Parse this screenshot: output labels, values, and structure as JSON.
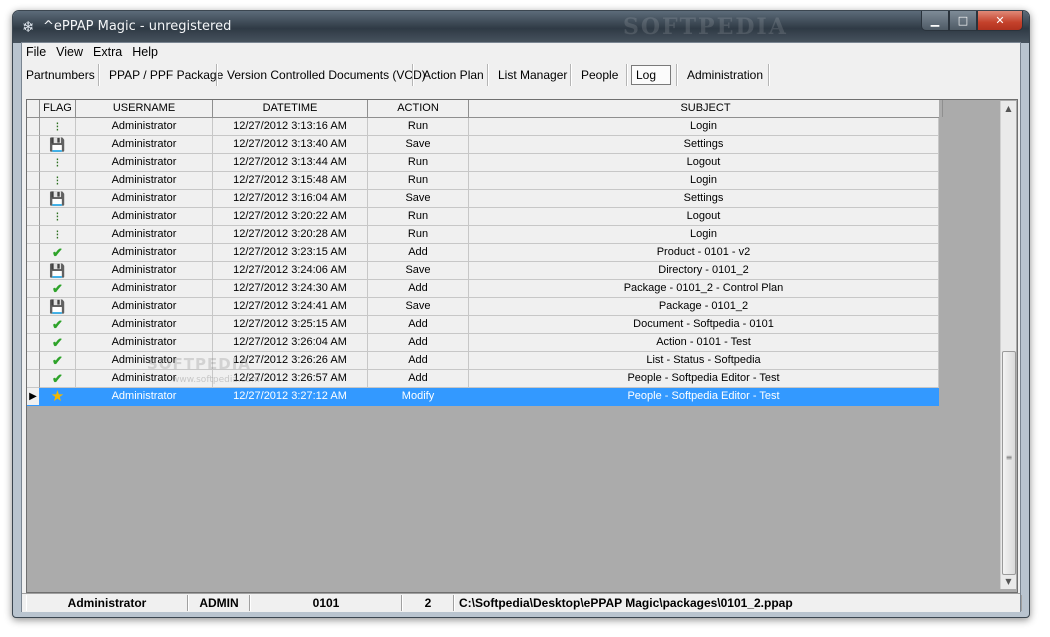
{
  "window": {
    "title": "^ePPAP Magic - unregistered",
    "watermark": "SOFTPEDIA",
    "icon": "gear-icon",
    "buttons": {
      "minimize": "minimize-icon",
      "maximize": "maximize-icon",
      "close": "close-icon"
    }
  },
  "menu": [
    "File",
    "View",
    "Extra",
    "Help"
  ],
  "nav": [
    "Partnumbers",
    "PPAP / PPF Package",
    "Version Controlled Documents (VCD)",
    "Action Plan",
    "List Manager",
    "People",
    "Log",
    "Administration"
  ],
  "nav_active": "Log",
  "table": {
    "headers": [
      "FLAG",
      "USERNAME",
      "DATETIME",
      "ACTION",
      "SUBJECT"
    ],
    "rows": [
      {
        "flag": "traffic-light-icon",
        "username": "Administrator",
        "datetime": "12/27/2012 3:13:16 AM",
        "action": "Run",
        "subject": "Login"
      },
      {
        "flag": "floppy-disk-icon",
        "username": "Administrator",
        "datetime": "12/27/2012 3:13:40 AM",
        "action": "Save",
        "subject": "Settings"
      },
      {
        "flag": "traffic-light-icon",
        "username": "Administrator",
        "datetime": "12/27/2012 3:13:44 AM",
        "action": "Run",
        "subject": "Logout"
      },
      {
        "flag": "traffic-light-icon",
        "username": "Administrator",
        "datetime": "12/27/2012 3:15:48 AM",
        "action": "Run",
        "subject": "Login"
      },
      {
        "flag": "floppy-disk-icon",
        "username": "Administrator",
        "datetime": "12/27/2012 3:16:04 AM",
        "action": "Save",
        "subject": "Settings"
      },
      {
        "flag": "traffic-light-icon",
        "username": "Administrator",
        "datetime": "12/27/2012 3:20:22 AM",
        "action": "Run",
        "subject": "Logout"
      },
      {
        "flag": "traffic-light-icon",
        "username": "Administrator",
        "datetime": "12/27/2012 3:20:28 AM",
        "action": "Run",
        "subject": "Login"
      },
      {
        "flag": "checkmark-icon",
        "username": "Administrator",
        "datetime": "12/27/2012 3:23:15 AM",
        "action": "Add",
        "subject": "Product - 0101 - v2"
      },
      {
        "flag": "floppy-disk-icon",
        "username": "Administrator",
        "datetime": "12/27/2012 3:24:06 AM",
        "action": "Save",
        "subject": "Directory - 0101_2"
      },
      {
        "flag": "checkmark-icon",
        "username": "Administrator",
        "datetime": "12/27/2012 3:24:30 AM",
        "action": "Add",
        "subject": "Package - 0101_2 - Control Plan"
      },
      {
        "flag": "floppy-disk-icon",
        "username": "Administrator",
        "datetime": "12/27/2012 3:24:41 AM",
        "action": "Save",
        "subject": "Package - 0101_2"
      },
      {
        "flag": "checkmark-icon",
        "username": "Administrator",
        "datetime": "12/27/2012 3:25:15 AM",
        "action": "Add",
        "subject": "Document - Softpedia - 0101"
      },
      {
        "flag": "checkmark-icon",
        "username": "Administrator",
        "datetime": "12/27/2012 3:26:04 AM",
        "action": "Add",
        "subject": "Action - 0101 - Test"
      },
      {
        "flag": "checkmark-icon",
        "username": "Administrator",
        "datetime": "12/27/2012 3:26:26 AM",
        "action": "Add",
        "subject": "List - Status - Softpedia"
      },
      {
        "flag": "checkmark-icon",
        "username": "Administrator",
        "datetime": "12/27/2012 3:26:57 AM",
        "action": "Add",
        "subject": "People - Softpedia Editor - Test"
      },
      {
        "flag": "star-icon",
        "username": "Administrator",
        "datetime": "12/27/2012 3:27:12 AM",
        "action": "Modify",
        "subject": "People - Softpedia Editor - Test",
        "selected": true
      }
    ]
  },
  "status": {
    "user": "Administrator",
    "role": "ADMIN",
    "partnumber": "0101",
    "count": "2",
    "path": "C:\\Softpedia\\Desktop\\ePPAP Magic\\packages\\0101_2.ppap"
  },
  "colors": {
    "selection": "#3399ff",
    "check": "#2ea32a",
    "star": "#f2b800"
  }
}
